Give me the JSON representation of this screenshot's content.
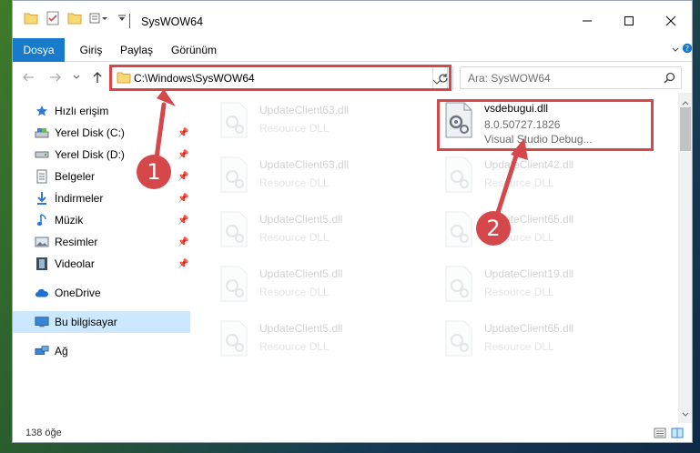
{
  "window": {
    "title": "SysWOW64"
  },
  "ribbon": {
    "tabs": [
      "Dosya",
      "Giriş",
      "Paylaş",
      "Görünüm"
    ]
  },
  "address": {
    "path": "C:\\Windows\\SysWOW64"
  },
  "search": {
    "placeholder": "Ara: SysWOW64"
  },
  "sidebar": {
    "items": [
      {
        "label": "Hızlı erişim",
        "icon": "star-icon"
      },
      {
        "label": "Yerel Disk (C:)",
        "icon": "drive-icon"
      },
      {
        "label": "Yerel Disk (D:)",
        "icon": "drive-icon"
      },
      {
        "label": "Belgeler",
        "icon": "documents-icon"
      },
      {
        "label": "İndirmeler",
        "icon": "download-icon"
      },
      {
        "label": "Müzik",
        "icon": "music-icon"
      },
      {
        "label": "Resimler",
        "icon": "pictures-icon"
      },
      {
        "label": "Videolar",
        "icon": "videos-icon"
      },
      {
        "label": "OneDrive",
        "icon": "cloud-icon"
      },
      {
        "label": "Bu bilgisayar",
        "icon": "computer-icon"
      },
      {
        "label": "Ağ",
        "icon": "network-icon"
      }
    ]
  },
  "files": [
    {
      "name": "UpdateClient63.dll",
      "desc": "Resource DLL"
    },
    {
      "name": "vsdebugui.dll",
      "version": "8.0.50727.1826",
      "desc": "Visual Studio Debug..."
    },
    {
      "name": "UpdateClient63.dll",
      "desc": "Resource DLL"
    },
    {
      "name": "UpdateClient42.dll",
      "desc": "Resource DLL"
    },
    {
      "name": "UpdateClient5.dll",
      "desc": "Resource DLL"
    },
    {
      "name": "UpdateClient65.dll",
      "desc": "Resource DLL"
    },
    {
      "name": "UpdateClient5.dll",
      "desc": "Resource DLL"
    },
    {
      "name": "UpdateClient19.dll",
      "desc": "Resource DLL"
    },
    {
      "name": "UpdateClient5.dll",
      "desc": "Resource DLL"
    },
    {
      "name": "UpdateClient65.dll",
      "desc": "Resource DLL"
    }
  ],
  "status": {
    "count": "138 öğe"
  },
  "annotations": {
    "badge1": "1",
    "badge2": "2"
  },
  "colors": {
    "accent": "#1979ca",
    "highlight": "#d6474b",
    "selected": "#cce8ff"
  }
}
